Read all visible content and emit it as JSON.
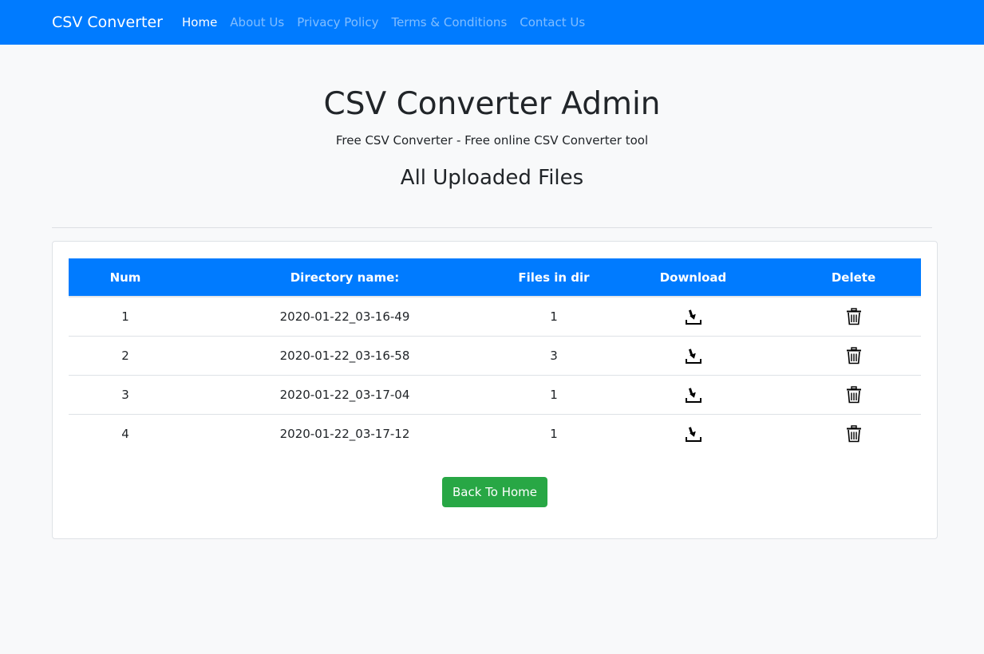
{
  "nav": {
    "brand": "CSV Converter",
    "links": [
      {
        "label": "Home",
        "active": true
      },
      {
        "label": "About Us"
      },
      {
        "label": "Privacy Policy"
      },
      {
        "label": "Terms & Conditions"
      },
      {
        "label": "Contact Us"
      }
    ]
  },
  "header": {
    "title": "CSV Converter Admin",
    "subtitle": "Free CSV Converter - Free online CSV Converter tool",
    "section_title": "All Uploaded Files"
  },
  "table": {
    "columns": [
      "Num",
      "Directory name:",
      "Files in dir",
      "Download",
      "Delete"
    ],
    "rows": [
      {
        "num": "1",
        "dir": "2020-01-22_03-16-49",
        "files": "1",
        "download_icon": "download-icon",
        "delete_icon": "trash-icon"
      },
      {
        "num": "2",
        "dir": "2020-01-22_03-16-58",
        "files": "3",
        "download_icon": "download-icon",
        "delete_icon": "trash-icon"
      },
      {
        "num": "3",
        "dir": "2020-01-22_03-17-04",
        "files": "1",
        "download_icon": "download-icon",
        "delete_icon": "trash-icon"
      },
      {
        "num": "4",
        "dir": "2020-01-22_03-17-12",
        "files": "1",
        "download_icon": "download-icon",
        "delete_icon": "trash-icon"
      }
    ]
  },
  "actions": {
    "back_label": "Back To Home"
  },
  "colors": {
    "navbar": "#007bff",
    "table_header": "#007bff",
    "success_button": "#28a745",
    "background": "#f8f9fa"
  }
}
